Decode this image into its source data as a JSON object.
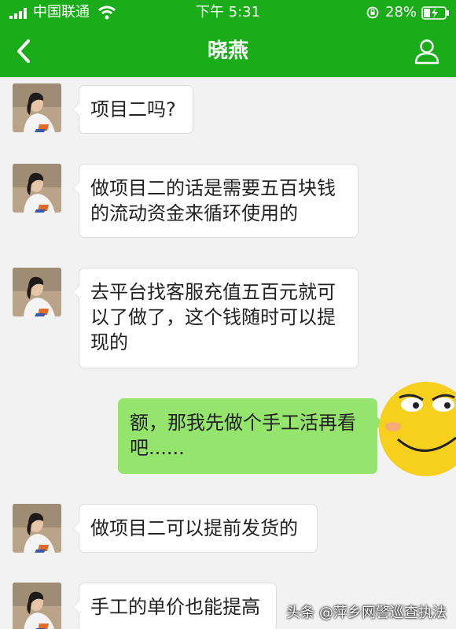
{
  "status_bar": {
    "carrier": "中国联通",
    "time": "下午 5:31",
    "battery_percent": "28%"
  },
  "header": {
    "title": "晓燕",
    "background_color": "#1aad19"
  },
  "messages": [
    {
      "side": "left",
      "text": "项目二吗?"
    },
    {
      "side": "left",
      "text": "做项目二的话是需要五百块钱\n的流动资金来循环使用的"
    },
    {
      "side": "left",
      "text": "去平台找客服充值五百元就可\n以了做了，这个钱随时可以提\n现的"
    },
    {
      "side": "right",
      "text": "额，那我先做个手工活再看\n吧......"
    },
    {
      "side": "left",
      "text": "做项目二可以提前发货的"
    },
    {
      "side": "left",
      "text": "手工的单价也能提高"
    }
  ],
  "watermark": "头条 @萍乡网警巡查执法",
  "icons": {
    "back": "chevron-left-icon",
    "profile": "person-icon",
    "emoji": "smirk-emoji"
  },
  "colors": {
    "sent_bubble": "#95e46e",
    "received_bubble": "#ffffff"
  }
}
